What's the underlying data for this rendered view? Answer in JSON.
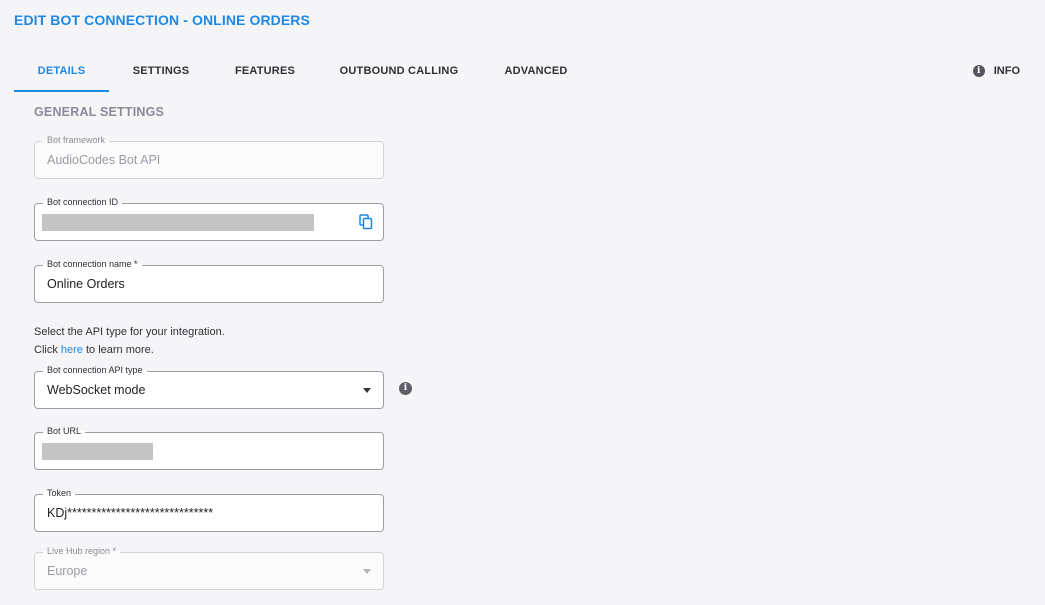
{
  "header": {
    "title": "EDIT BOT CONNECTION - ONLINE ORDERS"
  },
  "tabs": [
    {
      "label": "DETAILS",
      "active": true
    },
    {
      "label": "SETTINGS",
      "active": false
    },
    {
      "label": "FEATURES",
      "active": false
    },
    {
      "label": "OUTBOUND CALLING",
      "active": false
    },
    {
      "label": "ADVANCED",
      "active": false
    }
  ],
  "info_tab": {
    "label": "INFO",
    "icon": "info-icon"
  },
  "section": {
    "title": "GENERAL SETTINGS"
  },
  "fields": {
    "bot_framework": {
      "label": "Bot framework",
      "value": "AudioCodes Bot API",
      "disabled": true
    },
    "bot_connection_id": {
      "label": "Bot connection ID",
      "value": "",
      "redacted": true,
      "icon": "copy-icon"
    },
    "bot_connection_name": {
      "label": "Bot connection name *",
      "value": "Online Orders"
    },
    "api_type": {
      "label": "Bot connection API type",
      "value": "WebSocket mode",
      "icon": "chevron-down-icon"
    },
    "bot_url": {
      "label": "Bot URL",
      "value": "",
      "redacted": true
    },
    "token": {
      "label": "Token",
      "value": "KDj******************************"
    },
    "live_hub_region": {
      "label": "Live Hub region *",
      "value": "Europe",
      "disabled": true,
      "icon": "chevron-down-icon"
    }
  },
  "help": {
    "line1": "Select the API type for your integration.",
    "line2_prefix": "Click ",
    "link": "here",
    "line2_suffix": " to learn more."
  },
  "colors": {
    "accent": "#1e88e5",
    "background": "#f5f5f7",
    "muted": "#8a8a9a"
  }
}
